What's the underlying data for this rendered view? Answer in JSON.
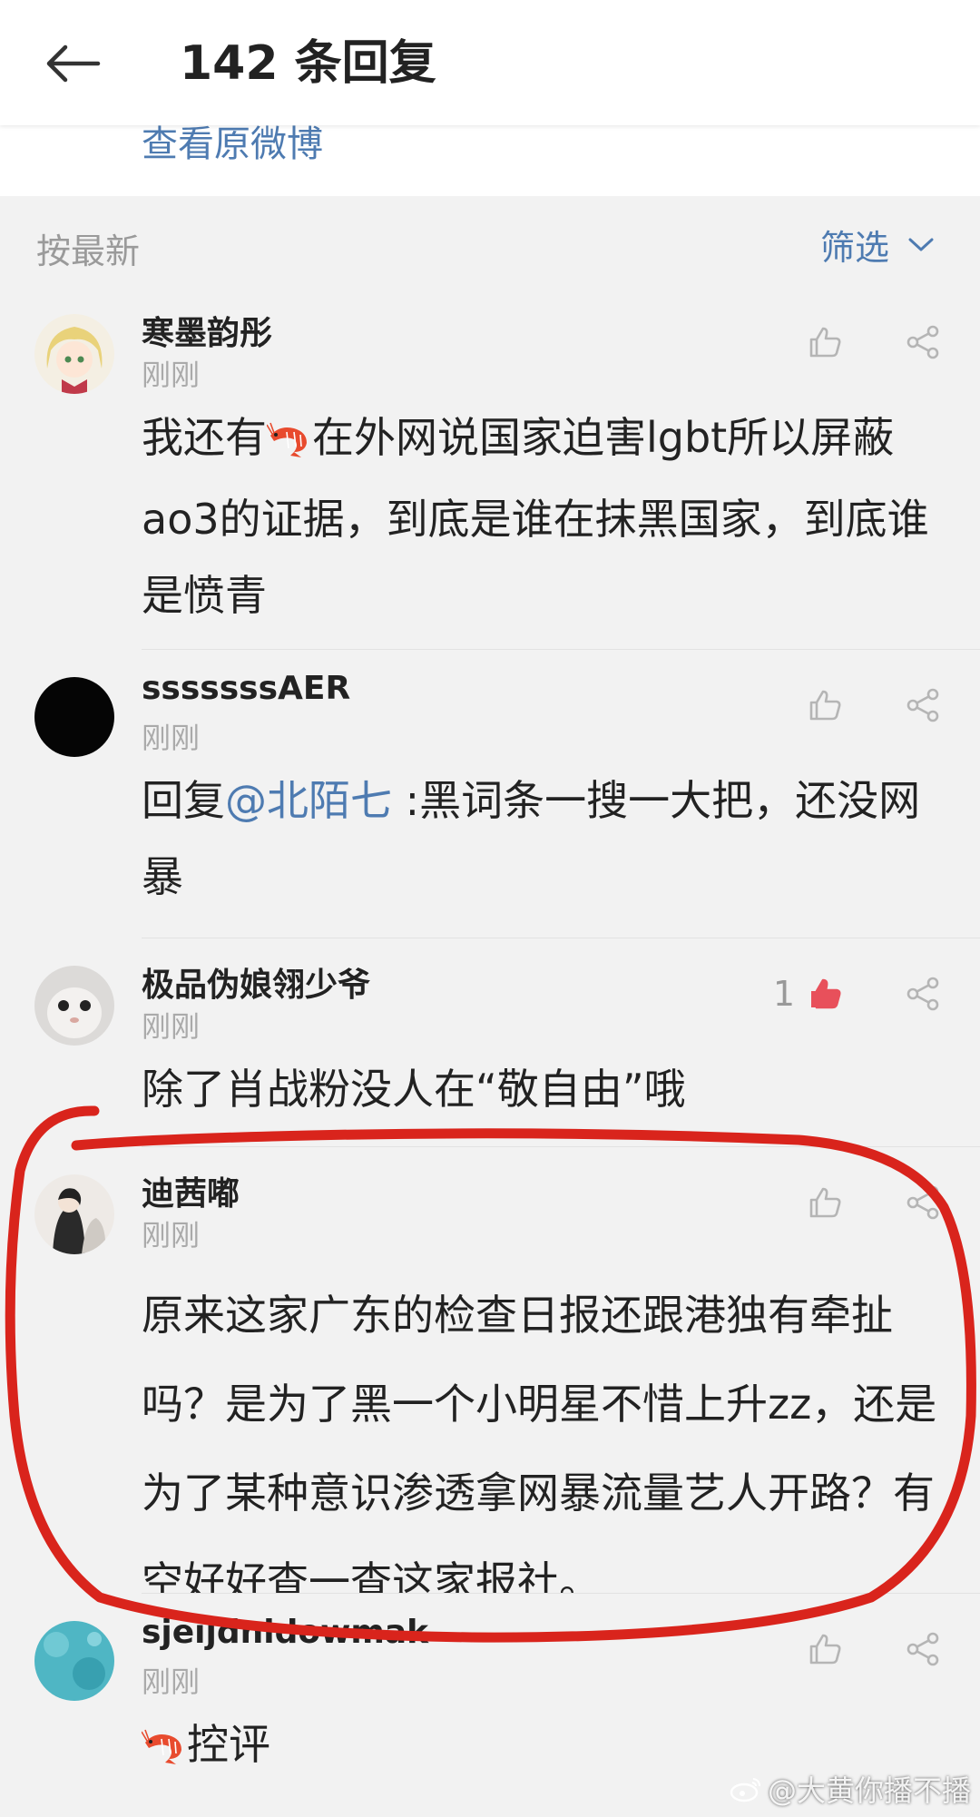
{
  "header": {
    "title": "142 条回复"
  },
  "view_original": "查看原微博",
  "sort": {
    "label": "按最新",
    "filter_label": "筛选"
  },
  "comments": [
    {
      "username": "寒墨韵彤",
      "time": "刚刚",
      "like_count": "",
      "liked": false,
      "text_before": "我还有",
      "text_after": "在外网说国家迫害lgbt所以屏蔽ao3的证据，到底是谁在抹黑国家，到底谁是愤青"
    },
    {
      "username": "sssssssAER",
      "time": "刚刚",
      "like_count": "",
      "liked": false,
      "reply_prefix": "回复",
      "mention": "@北陌七",
      "text": " :黑词条一搜一大把，还没网暴"
    },
    {
      "username": "极品伪娘翎少爷",
      "time": "刚刚",
      "like_count": "1",
      "liked": true,
      "text": "除了肖战粉没人在“敬自由”哦"
    },
    {
      "username": "迪茜嘟",
      "time": "刚刚",
      "like_count": "",
      "liked": false,
      "text": "原来这家广东的检查日报还跟港独有牵扯吗？是为了黑一个小明星不惜上升zz，还是为了某种意识渗透拿网暴流量艺人开路？有空好好查一查这家报社。"
    },
    {
      "username": "sjeijdnidowmak",
      "time": "刚刚",
      "like_count": "",
      "liked": false,
      "text": "控评"
    }
  ],
  "watermark": "@大黄你播不播",
  "colors": {
    "link": "#4e7bb1",
    "like_active": "#e8505b",
    "annotation": "#d9241c"
  },
  "icons": [
    "back-arrow-icon",
    "chevron-down-icon",
    "thumbs-up-icon",
    "share-icon",
    "shrimp-emoji-icon",
    "weibo-logo-icon"
  ]
}
